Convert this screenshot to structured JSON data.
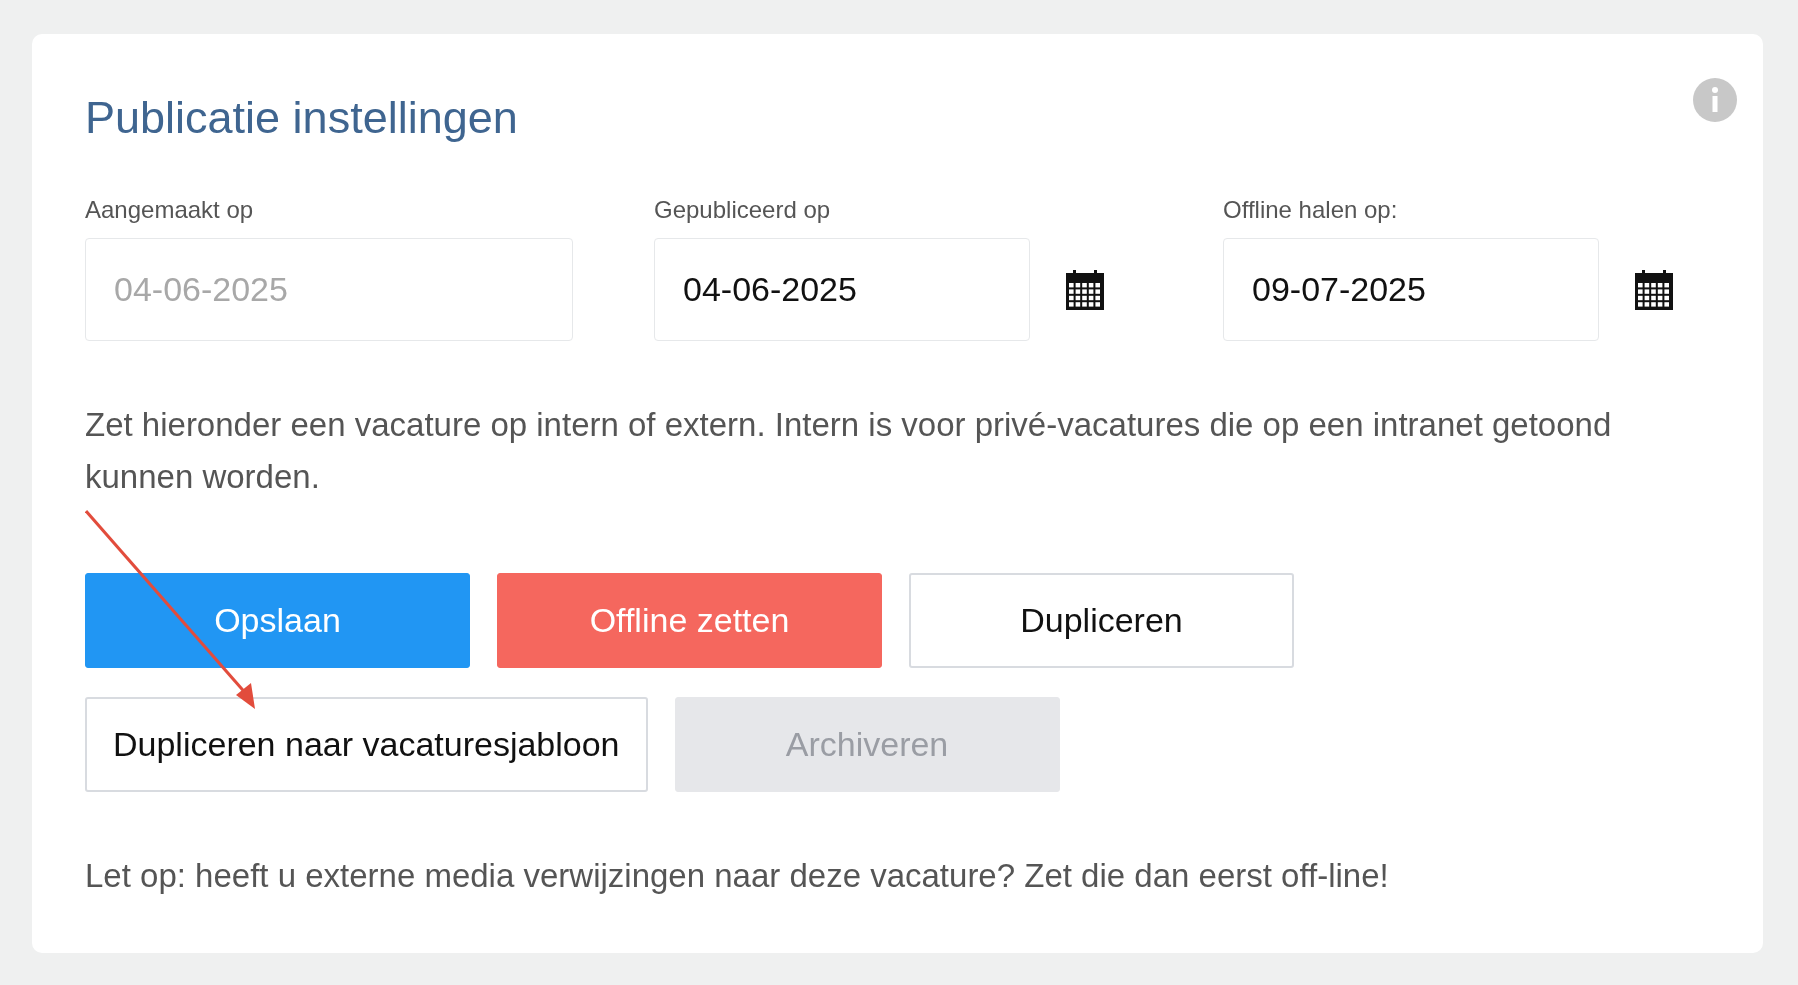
{
  "card": {
    "title": "Publicatie instellingen"
  },
  "fields": [
    {
      "label": "Aangemaakt op",
      "value": "04-06-2025",
      "kind": "readonly"
    },
    {
      "label": "Gepubliceerd op",
      "value": "04-06-2025",
      "kind": "datepicker"
    },
    {
      "label": "Offline halen op:",
      "value": "09-07-2025",
      "kind": "datepicker"
    }
  ],
  "description": "Zet hieronder een vacature op intern of extern. Intern is voor privé-vacatures die op een intranet getoond kunnen worden.",
  "button_rows": [
    [
      {
        "label": "Opslaan",
        "kind": "primary"
      },
      {
        "label": "Offline zetten",
        "kind": "danger"
      },
      {
        "label": "Dupliceren",
        "kind": "outline"
      }
    ],
    [
      {
        "label": "Dupliceren naar vacaturesjabloon",
        "kind": "outline"
      },
      {
        "label": "Archiveren",
        "kind": "disabled"
      }
    ]
  ],
  "note": "Let op: heeft u externe media verwijzingen naar deze vacature? Zet die dan eerst off-line!"
}
